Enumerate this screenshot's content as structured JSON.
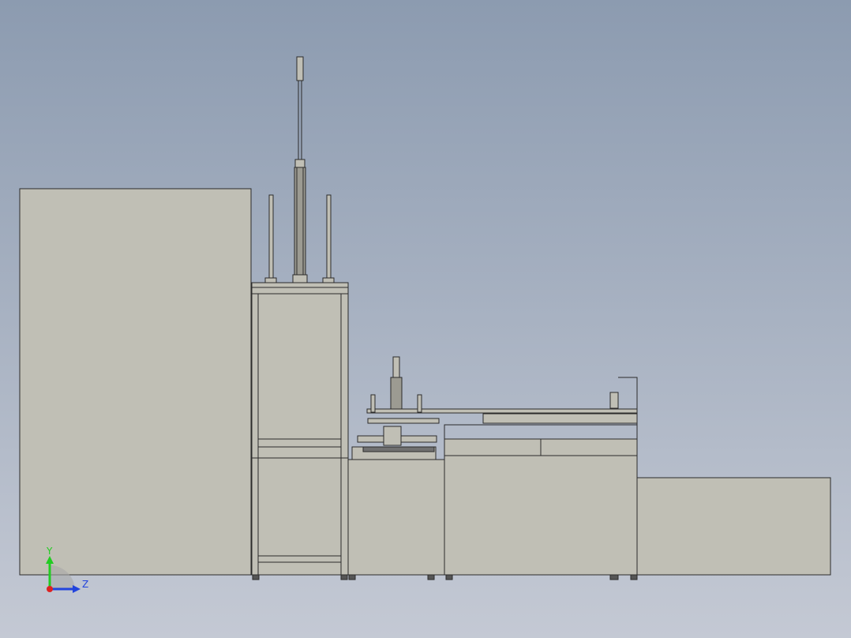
{
  "view": {
    "background_top": "#8c9bb0",
    "background_bottom": "#c4c9d4",
    "body_fill": "#c0bfb5",
    "edge_color": "#2b2b2b"
  },
  "triad": {
    "y_label": "Y",
    "z_label": "Z",
    "y_color": "#22cc22",
    "z_color": "#2244dd",
    "origin_color": "#dd2222"
  },
  "components": [
    "left-cabinet",
    "lifting-tower",
    "vertical-cylinder",
    "guide-rods",
    "feeder-module",
    "transfer-table",
    "right-conveyor-base",
    "leveling-feet"
  ]
}
